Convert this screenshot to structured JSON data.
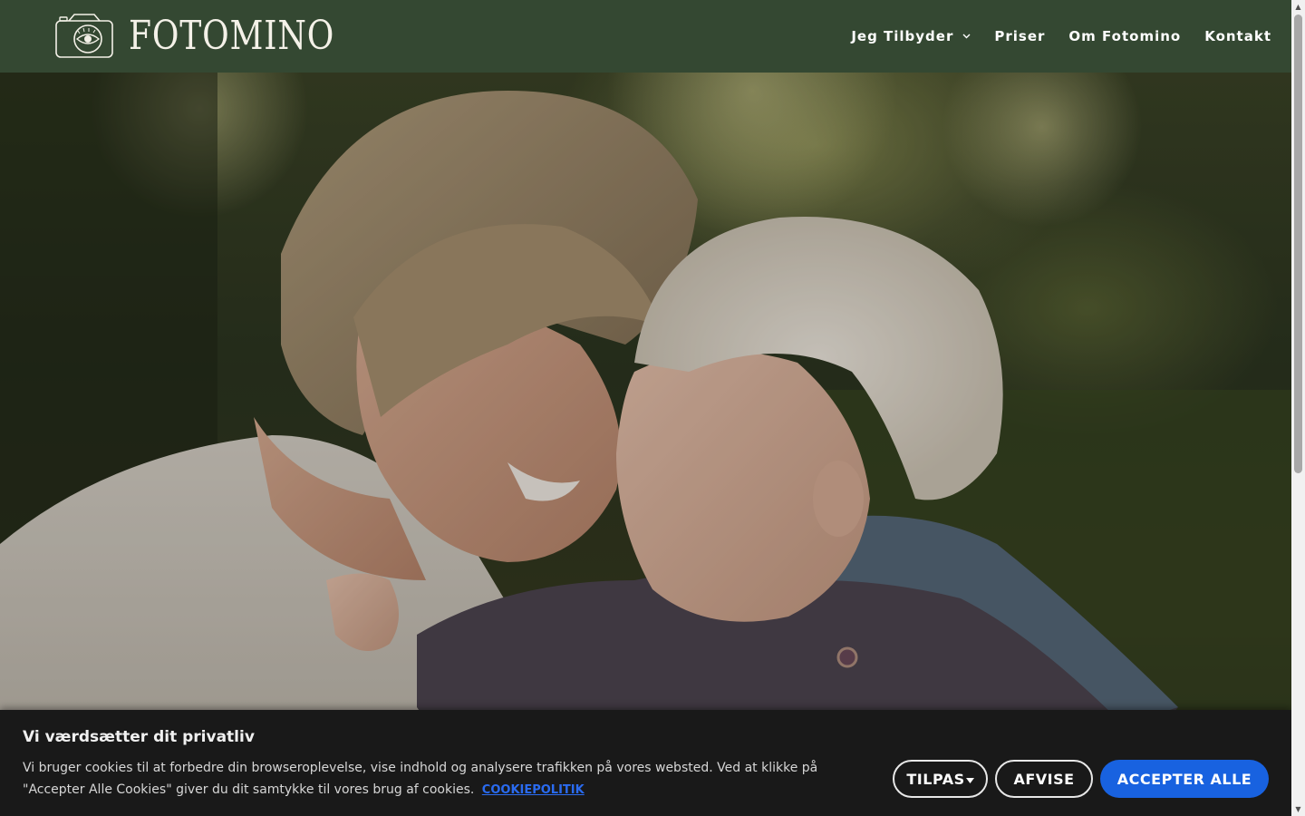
{
  "header": {
    "logo_text": "FOTOMINO",
    "logo_icon": "camera-eye-icon",
    "background": "#344832"
  },
  "nav": {
    "items": [
      {
        "label": "Jeg Tilbyder",
        "has_dropdown": true
      },
      {
        "label": "Priser"
      },
      {
        "label": "Om Fotomino"
      },
      {
        "label": "Kontakt"
      }
    ]
  },
  "hero": {
    "image": "mother-and-child-photo"
  },
  "cookie": {
    "title": "Vi værdsætter dit privatliv",
    "text": "Vi bruger cookies til at forbedre din browseroplevelse, vise indhold og analysere trafikken på vores websted. Ved at klikke på \"Accepter Alle Cookies\" giver du dit samtykke til vores brug af cookies.",
    "link_label": "COOKIEPOLITIK",
    "buttons": {
      "customize": "TILPAS",
      "reject": "AFVISE",
      "accept": "ACCEPTER ALLE"
    },
    "accent": "#1862e0"
  }
}
